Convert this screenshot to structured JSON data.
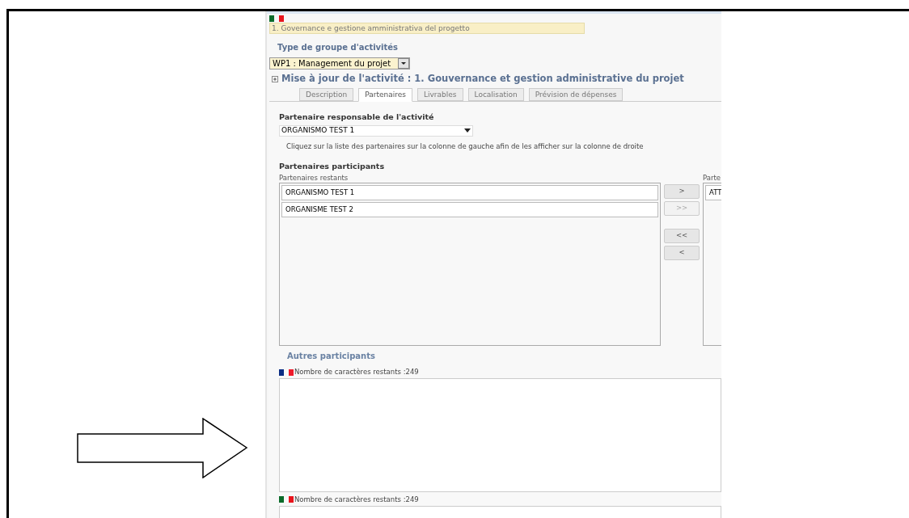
{
  "top_flag": {
    "kind": "italian"
  },
  "activity_name": "1. Governance e gestione amministrativa del progetto",
  "group_type": {
    "label": "Type de groupe d'activités",
    "value": "WP1 : Management du projet"
  },
  "section_title": "Mise à jour de l'activité : 1. Gouvernance et gestion administrative du projet",
  "tabs": [
    {
      "label": "Description",
      "selected": false
    },
    {
      "label": "Partenaires",
      "selected": true
    },
    {
      "label": "Livrables",
      "selected": false
    },
    {
      "label": "Localisation",
      "selected": false
    },
    {
      "label": "Prévision de dépenses",
      "selected": false
    }
  ],
  "responsible_partner": {
    "label": "Partenaire responsable de l'activité",
    "value": "ORGANISMO TEST 1"
  },
  "instruction": "Cliquez sur la liste des partenaires sur la colonne de gauche afin de les afficher sur la colonne de droite",
  "participants": {
    "title": "Partenaires participants",
    "remaining_label": "Partenaires restants",
    "remaining": [
      "ORGANISMO TEST 1",
      "ORGANISME TEST 2"
    ],
    "buttons": [
      {
        "label": ">",
        "disabled": false
      },
      {
        "label": ">>",
        "disabled": true
      },
      {
        "label": "<<",
        "disabled": false
      },
      {
        "label": "<",
        "disabled": false
      }
    ],
    "selected_label": "Parte",
    "selected": [
      "ATT"
    ]
  },
  "other_participants": {
    "title": "Autres participants",
    "fields": [
      {
        "kind": "french",
        "counter": "Nombre de caractères restants :249"
      },
      {
        "kind": "italian",
        "counter": "Nombre de caractères restants :249"
      }
    ]
  }
}
